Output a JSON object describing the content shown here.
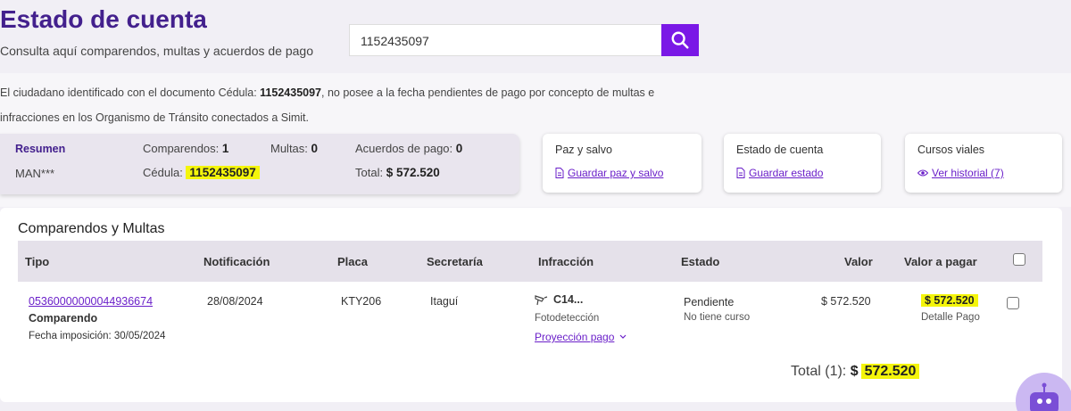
{
  "header": {
    "title": "Estado de cuenta",
    "subtitle": "Consulta aquí comparendos, multas y acuerdos de pago"
  },
  "search": {
    "value": "1152435097"
  },
  "info": {
    "prefix": "El ciudadano identificado con el documento Cédula: ",
    "document": "1152435097",
    "line1_rest": ", no posee a la fecha pendientes de pago por concepto de multas e",
    "line2": "infracciones en los Organismo de Tránsito conectados a Simit."
  },
  "summary": {
    "label": "Resumen",
    "name": "MAN***",
    "comparendos_label": "Comparendos: ",
    "comparendos_value": "1",
    "multas_label": "Multas: ",
    "multas_value": "0",
    "acuerdos_label": "Acuerdos de pago: ",
    "acuerdos_value": "0",
    "cedula_label": "Cédula: ",
    "cedula_value": "1152435097",
    "total_label": "Total: ",
    "total_value": "$ 572.520"
  },
  "cards": {
    "paz": {
      "title": "Paz y salvo",
      "link": "Guardar paz y salvo"
    },
    "estado": {
      "title": "Estado de cuenta",
      "link": "Guardar estado"
    },
    "cursos": {
      "title": "Cursos viales",
      "link": "Ver historial (7)"
    }
  },
  "table": {
    "title": "Comparendos y Multas",
    "headers": {
      "tipo": "Tipo",
      "notificacion": "Notificación",
      "placa": "Placa",
      "secretaria": "Secretaría",
      "infraccion": "Infracción",
      "estado": "Estado",
      "valor": "Valor",
      "valor_pagar": "Valor a pagar"
    },
    "row": {
      "numero": "05360000000044936674",
      "tipo": "Comparendo",
      "fecha_imposicion": "Fecha imposición: 30/05/2024",
      "notificacion": "28/08/2024",
      "placa": "KTY206",
      "secretaria": "Itaguí",
      "infraccion": "C14...",
      "deteccion": "Fotodetección",
      "proyeccion": "Proyección pago",
      "estado": "Pendiente",
      "curso": "No tiene curso",
      "valor": "$ 572.520",
      "valor_pagar": "$ 572.520",
      "detalle": "Detalle Pago"
    },
    "total_label": "Total (1):",
    "total_currency": "$",
    "total_value": "572.520"
  },
  "colors": {
    "brand_purple": "#43208d",
    "button_purple": "#7a18e6",
    "highlight": "#f4f50b",
    "link": "#6a1fc9"
  }
}
